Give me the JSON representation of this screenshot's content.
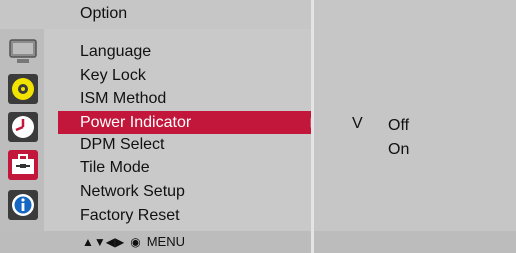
{
  "header": {
    "title": "Option"
  },
  "menu": {
    "items": [
      {
        "label": "Language"
      },
      {
        "label": "Key Lock"
      },
      {
        "label": "ISM Method"
      },
      {
        "label": "Power Indicator",
        "selected": true
      },
      {
        "label": "DPM Select"
      },
      {
        "label": "Tile Mode"
      },
      {
        "label": "Network Setup"
      },
      {
        "label": "Factory Reset"
      }
    ],
    "selected_arrow": "▶"
  },
  "submenu": {
    "check_mark": "V",
    "options": [
      {
        "label": "Off",
        "checked": true
      },
      {
        "label": "On",
        "checked": false
      }
    ]
  },
  "footer": {
    "nav_arrows": "▲▼◀▶",
    "ok_symbol": "◉",
    "menu_label": "MENU"
  },
  "icons": [
    "picture-icon",
    "audio-icon",
    "time-icon",
    "option-icon",
    "information-icon"
  ],
  "colors": {
    "selection": "#c2163a",
    "panel": "#c9c9c9"
  }
}
